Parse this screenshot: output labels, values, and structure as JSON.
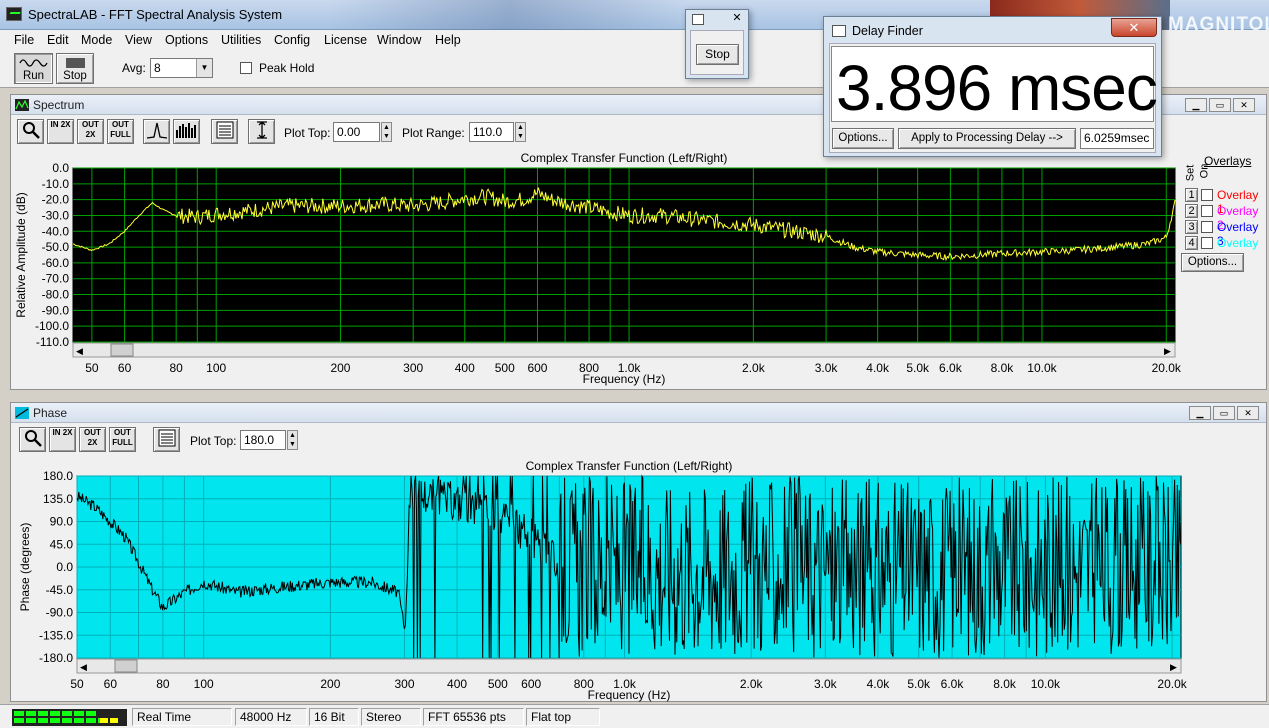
{
  "app": {
    "title": "SpectraLAB - FFT Spectral Analysis System",
    "watermark": "MAGNITOLA"
  },
  "menu": [
    "File",
    "Edit",
    "Mode",
    "View",
    "Options",
    "Utilities",
    "Config",
    "License",
    "Window",
    "Help"
  ],
  "toolbar": {
    "run_label": "Run",
    "stop_label": "Stop",
    "avg_label": "Avg:",
    "avg_value": "8",
    "peak_hold_label": "Peak Hold",
    "peak_hold_checked": false
  },
  "stop_popup": {
    "stop_label": "Stop"
  },
  "delay_finder": {
    "title": "Delay Finder",
    "value": "3.896 msec",
    "options_label": "Options...",
    "apply_label": "Apply to Processing Delay -->",
    "processing_delay": "6.0259msec"
  },
  "spectrum": {
    "title": "Spectrum",
    "tool_buttons": [
      "zoom-icon",
      "zoom-in-2x",
      "zoom-out-2x",
      "zoom-full",
      "peak-icon",
      "bar-icon",
      "table-icon",
      "scale-icon"
    ],
    "zin_label": "IN 2X",
    "zout_label": "OUT 2X",
    "zfull_label": "OUT FULL",
    "plot_top_label": "Plot Top:",
    "plot_top_value": "0.00",
    "plot_range_label": "Plot Range:",
    "plot_range_value": "110.0",
    "overlays": {
      "header": "Overlays",
      "set_label": "Set",
      "on_label": "On",
      "items": [
        {
          "n": "1",
          "label": "Overlay 1",
          "color": "#ff0000"
        },
        {
          "n": "2",
          "label": "Overlay 2",
          "color": "#ff00ff"
        },
        {
          "n": "3",
          "label": "Overlay 3",
          "color": "#0000ff"
        },
        {
          "n": "4",
          "label": "Overlay 4",
          "color": "#00ffff"
        }
      ],
      "options_label": "Options..."
    }
  },
  "phase": {
    "title": "Phase",
    "zin_label": "IN 2X",
    "zout_label": "OUT 2X",
    "zfull_label": "OUT FULL",
    "plot_top_label": "Plot Top:",
    "plot_top_value": "180.0"
  },
  "chart_data": [
    {
      "type": "line",
      "title": "Complex Transfer Function (Left/Right)",
      "xlabel": "Frequency (Hz)",
      "ylabel": "Relative Amplitude (dB)",
      "x_scale": "log",
      "xlim": [
        45,
        21000
      ],
      "ylim": [
        -110,
        0
      ],
      "x_ticks": [
        50,
        60,
        80,
        100,
        200,
        300,
        400,
        500,
        600,
        800,
        1000,
        2000,
        3000,
        4000,
        5000,
        6000,
        8000,
        10000,
        20000
      ],
      "x_tick_labels": [
        "50",
        "60",
        "80",
        "100",
        "200",
        "300",
        "400",
        "500",
        "600",
        "800",
        "1.0k",
        "2.0k",
        "3.0k",
        "4.0k",
        "5.0k",
        "6.0k",
        "8.0k",
        "10.0k",
        "20.0k"
      ],
      "y_ticks": [
        0,
        -10,
        -20,
        -30,
        -40,
        -50,
        -60,
        -70,
        -80,
        -90,
        -100,
        -110
      ],
      "y_tick_labels": [
        "0.0",
        "-10.0",
        "-20.0",
        "-30.0",
        "-40.0",
        "-50.0",
        "-60.0",
        "-70.0",
        "-80.0",
        "-90.0",
        "-100.0",
        "-110.0"
      ],
      "background": "#000000",
      "grid_color": "#00a000",
      "series": [
        {
          "color": "#ffff33",
          "x": [
            45,
            50,
            55,
            60,
            65,
            70,
            75,
            80,
            90,
            100,
            120,
            150,
            200,
            250,
            300,
            350,
            400,
            450,
            500,
            550,
            600,
            650,
            700,
            800,
            900,
            1000,
            1200,
            1500,
            2000,
            2500,
            3000,
            3500,
            4000,
            5000,
            6000,
            7000,
            8000,
            10000,
            12000,
            15000,
            18000,
            20000,
            21000
          ],
          "y": [
            -48,
            -52,
            -48,
            -40,
            -30,
            -22,
            -27,
            -30,
            -31,
            -29,
            -27,
            -24,
            -24,
            -23,
            -24,
            -22,
            -19,
            -18,
            -21,
            -20,
            -16,
            -20,
            -22,
            -25,
            -28,
            -30,
            -30,
            -33,
            -36,
            -40,
            -43,
            -50,
            -53,
            -55,
            -56,
            -55,
            -54,
            -53,
            -52,
            -50,
            -48,
            -44,
            -22
          ]
        }
      ]
    },
    {
      "type": "line",
      "title": "Complex Transfer Function (Left/Right)",
      "xlabel": "Frequency (Hz)",
      "ylabel": "Phase (degrees)",
      "x_scale": "log",
      "xlim": [
        50,
        21000
      ],
      "ylim": [
        -180,
        180
      ],
      "x_ticks": [
        50,
        60,
        80,
        100,
        200,
        300,
        400,
        500,
        600,
        800,
        1000,
        2000,
        3000,
        4000,
        5000,
        6000,
        8000,
        10000,
        20000
      ],
      "x_tick_labels": [
        "50",
        "60",
        "80",
        "100",
        "200",
        "300",
        "400",
        "500",
        "600",
        "800",
        "1.0k",
        "2.0k",
        "3.0k",
        "4.0k",
        "5.0k",
        "6.0k",
        "8.0k",
        "10.0k",
        "20.0k"
      ],
      "y_ticks": [
        180,
        135,
        90,
        45,
        0,
        -45,
        -90,
        -135,
        -180
      ],
      "y_tick_labels": [
        "180.0",
        "135.0",
        "90.0",
        "45.0",
        "0.0",
        "-45.0",
        "-90.0",
        "-135.0",
        "-180.0"
      ],
      "background": "#00e5ee",
      "grid_color": "#00b0b8",
      "series": [
        {
          "color": "#000000",
          "x": [
            50,
            55,
            60,
            65,
            70,
            75,
            80,
            90,
            100,
            120,
            150,
            200,
            250,
            290,
            300,
            310,
            350,
            400,
            450,
            500,
            550,
            600,
            700,
            800,
            1000,
            1500,
            2000,
            3000,
            5000,
            10000,
            20000
          ],
          "y": [
            140,
            120,
            90,
            60,
            10,
            -40,
            -80,
            -50,
            -30,
            -50,
            -40,
            -30,
            -30,
            -50,
            -120,
            150,
            140,
            130,
            120,
            100,
            80,
            60,
            0,
            -60,
            -80,
            0,
            -60,
            0,
            0,
            0,
            0
          ]
        }
      ]
    }
  ],
  "status": {
    "real_time": "Real Time",
    "rate": "48000 Hz",
    "bits": "16 Bit",
    "channels": "Stereo",
    "fft": "FFT 65536 pts",
    "window": "Flat top"
  }
}
